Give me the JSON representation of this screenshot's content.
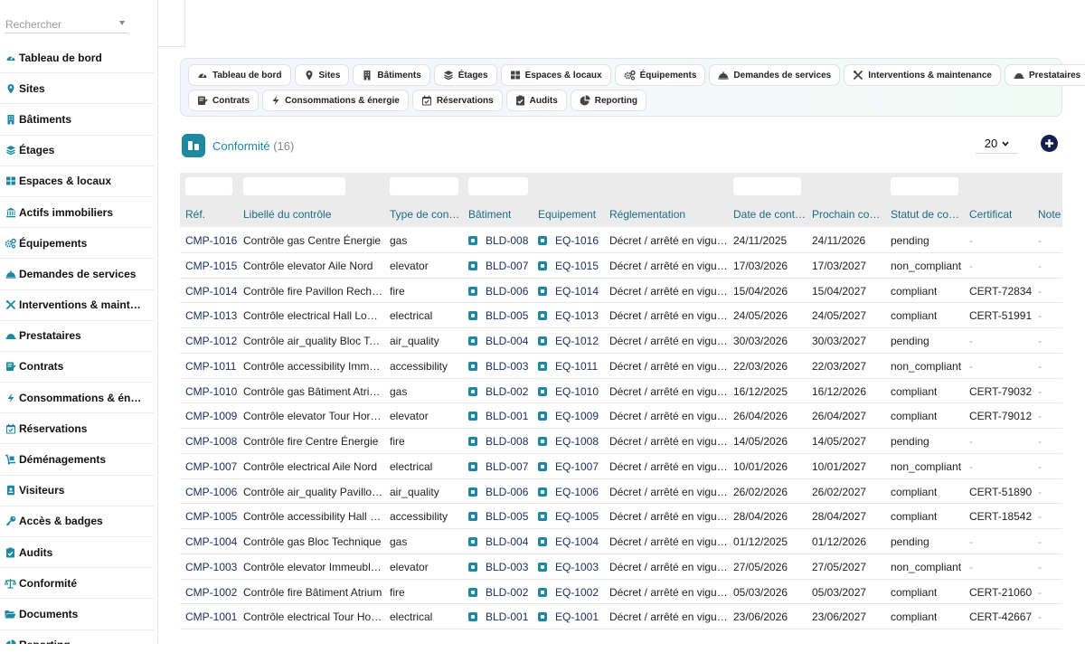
{
  "search": {
    "placeholder": "Rechercher"
  },
  "sidebar": {
    "items": [
      {
        "label": "Tableau de bord",
        "icon": "gauge-icon"
      },
      {
        "label": "Sites",
        "icon": "map-pin-icon"
      },
      {
        "label": "Bâtiments",
        "icon": "building-icon"
      },
      {
        "label": "Étages",
        "icon": "layers-icon"
      },
      {
        "label": "Espaces & locaux",
        "icon": "grid-icon"
      },
      {
        "label": "Actifs immobiliers",
        "icon": "landmark-icon"
      },
      {
        "label": "Équipements",
        "icon": "gears-icon"
      },
      {
        "label": "Demandes de services",
        "icon": "bell-icon"
      },
      {
        "label": "Interventions & maintenance",
        "icon": "tools-icon"
      },
      {
        "label": "Prestataires",
        "icon": "helmet-icon"
      },
      {
        "label": "Contrats",
        "icon": "contract-icon"
      },
      {
        "label": "Consommations & énergie",
        "icon": "bolt-icon"
      },
      {
        "label": "Réservations",
        "icon": "calendar-check-icon"
      },
      {
        "label": "Déménagements",
        "icon": "dolly-icon"
      },
      {
        "label": "Visiteurs",
        "icon": "id-badge-icon"
      },
      {
        "label": "Accès & badges",
        "icon": "key-icon"
      },
      {
        "label": "Audits",
        "icon": "clipboard-check-icon"
      },
      {
        "label": "Conformité",
        "icon": "scale-icon"
      },
      {
        "label": "Documents",
        "icon": "folder-open-icon"
      },
      {
        "label": "Reporting",
        "icon": "chart-pie-icon"
      }
    ]
  },
  "tabs": {
    "row1": [
      {
        "label": "Tableau de bord",
        "icon": "gauge-icon"
      },
      {
        "label": "Sites",
        "icon": "map-pin-icon"
      },
      {
        "label": "Bâtiments",
        "icon": "building-icon"
      },
      {
        "label": "Étages",
        "icon": "layers-icon"
      },
      {
        "label": "Espaces & locaux",
        "icon": "grid-icon"
      },
      {
        "label": "Équipements",
        "icon": "gears-icon"
      },
      {
        "label": "Demandes de services",
        "icon": "bell-icon"
      },
      {
        "label": "Interventions & maintenance",
        "icon": "tools-icon"
      },
      {
        "label": "Prestataires",
        "icon": "helmet-icon"
      }
    ],
    "row2": [
      {
        "label": "Contrats",
        "icon": "contract-icon"
      },
      {
        "label": "Consommations & énergie",
        "icon": "bolt-icon"
      },
      {
        "label": "Réservations",
        "icon": "calendar-check-icon"
      },
      {
        "label": "Audits",
        "icon": "clipboard-check-icon"
      },
      {
        "label": "Reporting",
        "icon": "chart-pie-icon"
      }
    ]
  },
  "header": {
    "title": "Conformité",
    "count": "(16)",
    "page_size": "20"
  },
  "colors": {
    "accent": "#1e88a0",
    "link": "#1a3060",
    "add_button": "#16204f"
  },
  "table": {
    "columns": [
      "Réf.",
      "Libellé du contrôle",
      "Type de cont…",
      "Bâtiment",
      "Equipement",
      "Réglementation",
      "Date de cont…",
      "Prochain co…",
      "Statut de co…",
      "Certificat",
      "Note"
    ],
    "rows": [
      {
        "ref": "CMP-1016",
        "label": "Contrôle gas Centre Énergie",
        "type": "gas",
        "building": "BLD-008",
        "equipment": "EQ-1016",
        "regulation": "Décret / arrêté en vigueur",
        "date": "24/11/2025",
        "next": "24/11/2026",
        "status": "pending",
        "certificate": "-",
        "note": "-"
      },
      {
        "ref": "CMP-1015",
        "label": "Contrôle elevator Aile Nord",
        "type": "elevator",
        "building": "BLD-007",
        "equipment": "EQ-1015",
        "regulation": "Décret / arrêté en vigueur",
        "date": "17/03/2026",
        "next": "17/03/2027",
        "status": "non_compliant",
        "certificate": "-",
        "note": "-"
      },
      {
        "ref": "CMP-1014",
        "label": "Contrôle fire Pavillon Recherche",
        "type": "fire",
        "building": "BLD-006",
        "equipment": "EQ-1014",
        "regulation": "Décret / arrêté en vigueur",
        "date": "15/04/2026",
        "next": "15/04/2027",
        "status": "compliant",
        "certificate": "CERT-72834",
        "note": "-"
      },
      {
        "ref": "CMP-1013",
        "label": "Contrôle electrical Hall Logistique",
        "type": "electrical",
        "building": "BLD-005",
        "equipment": "EQ-1013",
        "regulation": "Décret / arrêté en vigueur",
        "date": "24/05/2026",
        "next": "24/05/2027",
        "status": "compliant",
        "certificate": "CERT-51991",
        "note": "-"
      },
      {
        "ref": "CMP-1012",
        "label": "Contrôle air_quality Bloc Technique",
        "type": "air_quality",
        "building": "BLD-004",
        "equipment": "EQ-1012",
        "regulation": "Décret / arrêté en vigueur",
        "date": "30/03/2026",
        "next": "30/03/2027",
        "status": "pending",
        "certificate": "-",
        "note": "-"
      },
      {
        "ref": "CMP-1011",
        "label": "Contrôle accessibility Immeuble Siège",
        "type": "accessibility",
        "building": "BLD-003",
        "equipment": "EQ-1011",
        "regulation": "Décret / arrêté en vigueur",
        "date": "22/03/2026",
        "next": "22/03/2027",
        "status": "non_compliant",
        "certificate": "-",
        "note": "-"
      },
      {
        "ref": "CMP-1010",
        "label": "Contrôle gas Bâtiment Atrium",
        "type": "gas",
        "building": "BLD-002",
        "equipment": "EQ-1010",
        "regulation": "Décret / arrêté en vigueur",
        "date": "16/12/2025",
        "next": "16/12/2026",
        "status": "compliant",
        "certificate": "CERT-79032",
        "note": "-"
      },
      {
        "ref": "CMP-1009",
        "label": "Contrôle elevator Tour Horizon",
        "type": "elevator",
        "building": "BLD-001",
        "equipment": "EQ-1009",
        "regulation": "Décret / arrêté en vigueur",
        "date": "26/04/2026",
        "next": "26/04/2027",
        "status": "compliant",
        "certificate": "CERT-79012",
        "note": "-"
      },
      {
        "ref": "CMP-1008",
        "label": "Contrôle fire Centre Énergie",
        "type": "fire",
        "building": "BLD-008",
        "equipment": "EQ-1008",
        "regulation": "Décret / arrêté en vigueur",
        "date": "14/05/2026",
        "next": "14/05/2027",
        "status": "pending",
        "certificate": "-",
        "note": "-"
      },
      {
        "ref": "CMP-1007",
        "label": "Contrôle electrical Aile Nord",
        "type": "electrical",
        "building": "BLD-007",
        "equipment": "EQ-1007",
        "regulation": "Décret / arrêté en vigueur",
        "date": "10/01/2026",
        "next": "10/01/2027",
        "status": "non_compliant",
        "certificate": "-",
        "note": "-"
      },
      {
        "ref": "CMP-1006",
        "label": "Contrôle air_quality Pavillon Recherche",
        "type": "air_quality",
        "building": "BLD-006",
        "equipment": "EQ-1006",
        "regulation": "Décret / arrêté en vigueur",
        "date": "26/02/2026",
        "next": "26/02/2027",
        "status": "compliant",
        "certificate": "CERT-51890",
        "note": "-"
      },
      {
        "ref": "CMP-1005",
        "label": "Contrôle accessibility Hall Logistique",
        "type": "accessibility",
        "building": "BLD-005",
        "equipment": "EQ-1005",
        "regulation": "Décret / arrêté en vigueur",
        "date": "28/04/2026",
        "next": "28/04/2027",
        "status": "compliant",
        "certificate": "CERT-18542",
        "note": "-"
      },
      {
        "ref": "CMP-1004",
        "label": "Contrôle gas Bloc Technique",
        "type": "gas",
        "building": "BLD-004",
        "equipment": "EQ-1004",
        "regulation": "Décret / arrêté en vigueur",
        "date": "01/12/2025",
        "next": "01/12/2026",
        "status": "pending",
        "certificate": "-",
        "note": "-"
      },
      {
        "ref": "CMP-1003",
        "label": "Contrôle elevator Immeuble Siège",
        "type": "elevator",
        "building": "BLD-003",
        "equipment": "EQ-1003",
        "regulation": "Décret / arrêté en vigueur",
        "date": "27/05/2026",
        "next": "27/05/2027",
        "status": "non_compliant",
        "certificate": "-",
        "note": "-"
      },
      {
        "ref": "CMP-1002",
        "label": "Contrôle fire Bâtiment Atrium",
        "type": "fire",
        "building": "BLD-002",
        "equipment": "EQ-1002",
        "regulation": "Décret / arrêté en vigueur",
        "date": "05/03/2026",
        "next": "05/03/2027",
        "status": "compliant",
        "certificate": "CERT-21060",
        "note": "-"
      },
      {
        "ref": "CMP-1001",
        "label": "Contrôle electrical Tour Horizon",
        "type": "electrical",
        "building": "BLD-001",
        "equipment": "EQ-1001",
        "regulation": "Décret / arrêté en vigueur",
        "date": "23/06/2026",
        "next": "23/06/2027",
        "status": "compliant",
        "certificate": "CERT-42667",
        "note": "-"
      }
    ]
  }
}
